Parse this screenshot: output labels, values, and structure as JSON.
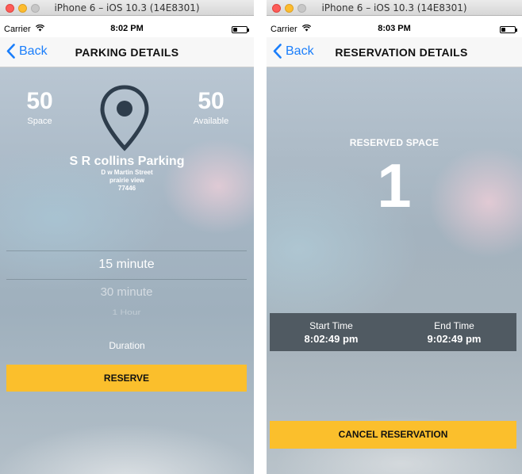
{
  "left": {
    "window_title": "iPhone 6 – iOS 10.3 (14E8301)",
    "carrier": "Carrier",
    "time": "8:02 PM",
    "battery_level": 0.3,
    "back_label": "Back",
    "title": "PARKING DETAILS",
    "space": {
      "value": "50",
      "label": "Space"
    },
    "available": {
      "value": "50",
      "label": "Available"
    },
    "lot_name": "S R collins Parking",
    "address": [
      "D w Martin Street",
      "prairie view",
      "77446"
    ],
    "duration_options": [
      "15 minute",
      "30 minute",
      "1 Hour"
    ],
    "duration_label": "Duration",
    "reserve_label": "RESERVE"
  },
  "right": {
    "window_title": "iPhone 6 – iOS 10.3 (14E8301)",
    "carrier": "Carrier",
    "time": "8:03 PM",
    "battery_level": 0.3,
    "back_label": "Back",
    "title": "RESERVATION DETAILS",
    "reserved_space_label": "RESERVED SPACE",
    "reserved_space_number": "1",
    "start_time_label": "Start Time",
    "start_time": "8:02:49 pm",
    "end_time_label": "End Time",
    "end_time": "9:02:49 pm",
    "cancel_label": "CANCEL RESERVATION"
  },
  "colors": {
    "accent_blue": "#1a7efb",
    "button_yellow": "#fbbf2c",
    "pin_dark": "#2e3d4c",
    "time_panel": "#505a62"
  },
  "icons": [
    "wifi-icon",
    "battery-icon",
    "back-chevron-icon",
    "location-pin-icon"
  ]
}
